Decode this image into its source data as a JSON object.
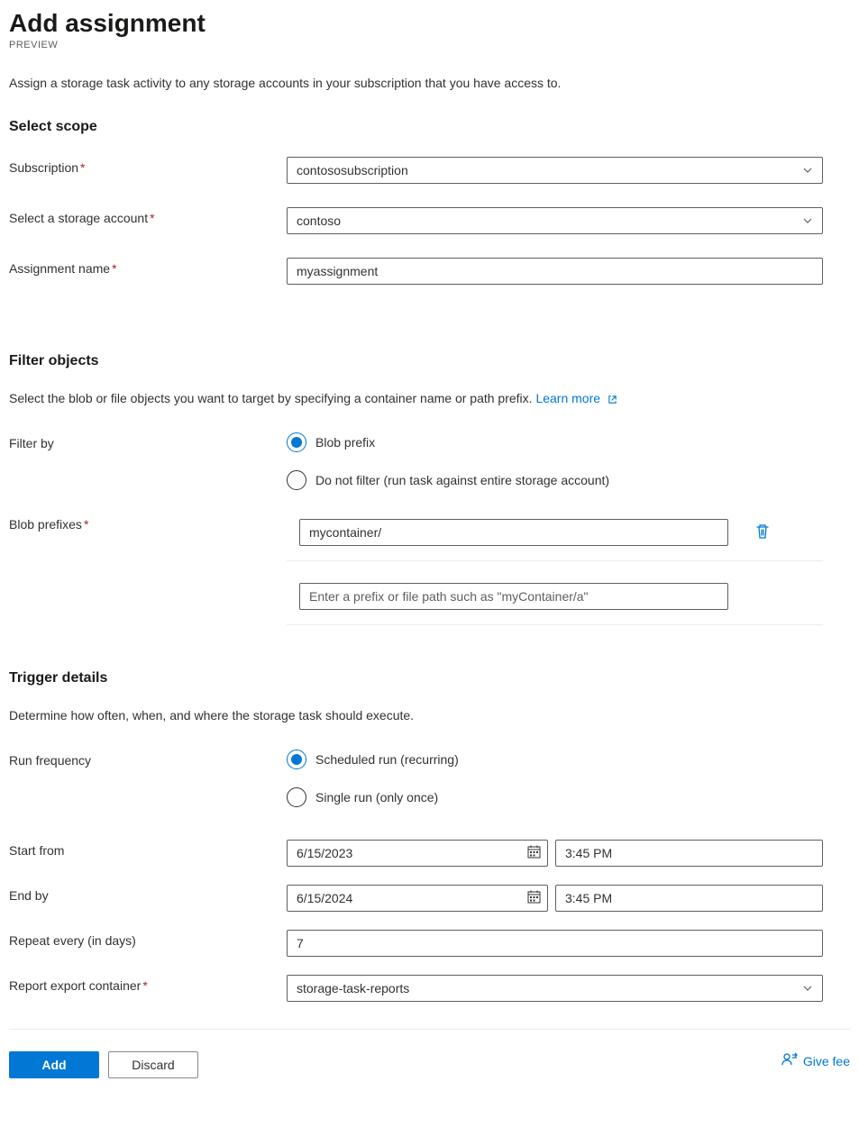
{
  "header": {
    "title": "Add assignment",
    "preview": "PREVIEW",
    "intro": "Assign a storage task activity to any storage accounts in your subscription that you have access to."
  },
  "scope": {
    "title": "Select scope",
    "subscription_label": "Subscription",
    "subscription_value": "contososubscription",
    "storage_label": "Select a storage account",
    "storage_value": "contoso",
    "assignment_label": "Assignment name",
    "assignment_value": "myassignment"
  },
  "filter": {
    "title": "Filter objects",
    "desc": "Select the blob or file objects you want to target by specifying a container name or path prefix.",
    "learn_more": "Learn more",
    "filter_by_label": "Filter by",
    "option_prefix": "Blob prefix",
    "option_nofilter": "Do not filter (run task against entire storage account)",
    "prefixes_label": "Blob prefixes",
    "prefix_value": "mycontainer/",
    "prefix_placeholder": "Enter a prefix or file path such as \"myContainer/a\""
  },
  "trigger": {
    "title": "Trigger details",
    "desc": "Determine how often, when, and where the storage task should execute.",
    "freq_label": "Run frequency",
    "option_scheduled": "Scheduled run (recurring)",
    "option_single": "Single run (only once)",
    "start_label": "Start from",
    "start_date": "6/15/2023",
    "start_time": "3:45 PM",
    "end_label": "End by",
    "end_date": "6/15/2024",
    "end_time": "3:45 PM",
    "repeat_label": "Repeat every (in days)",
    "repeat_value": "7",
    "report_label": "Report export container",
    "report_value": "storage-task-reports"
  },
  "footer": {
    "add": "Add",
    "discard": "Discard",
    "feedback": "Give fee"
  }
}
